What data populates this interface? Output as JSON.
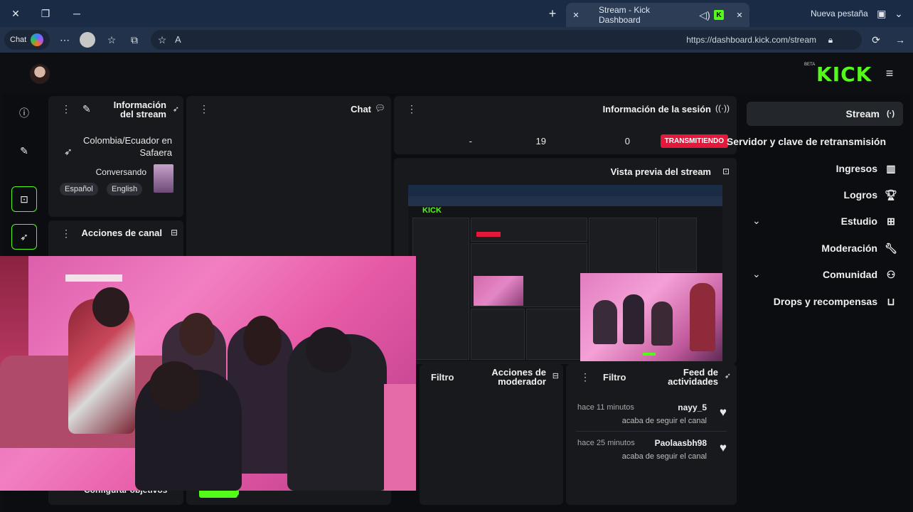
{
  "browser": {
    "tabs": [
      {
        "label": "Stream - Kick Dashboard",
        "active": true
      },
      {
        "label": "Nueva pestaña",
        "active": false
      }
    ],
    "url": "https://dashboard.kick.com/stream",
    "copilot_label": "Chat",
    "read_aloud": "A"
  },
  "brand": {
    "logo": "KICK",
    "badge": "BETA",
    "accent": "#53fc18"
  },
  "nav": {
    "items": [
      {
        "label": "Stream",
        "icon": "broadcast-icon",
        "active": true
      },
      {
        "label": "Servidor y clave de retransmisión",
        "icon": "",
        "active": false
      },
      {
        "label": "Ingresos",
        "icon": "bank-icon",
        "active": false
      },
      {
        "label": "Logros",
        "icon": "trophy-icon",
        "active": false
      },
      {
        "label": "Estudio",
        "icon": "studio-icon",
        "active": false,
        "expandable": true
      },
      {
        "label": "Moderación",
        "icon": "wrench-icon",
        "active": false
      },
      {
        "label": "Comunidad",
        "icon": "community-icon",
        "active": false,
        "expandable": true
      },
      {
        "label": "Drops y recompensas",
        "icon": "gift-icon",
        "active": false
      }
    ]
  },
  "session": {
    "title": "Información de la sesión",
    "status": "TRANSMITIENDO",
    "viewers": "0",
    "followers": "19",
    "duration": "-"
  },
  "preview": {
    "title": "Vista previa del stream"
  },
  "chat": {
    "title": "Chat"
  },
  "stream_info": {
    "title": "Información del stream",
    "stream_title": "Colombia/Ecuador en Safaera",
    "category": "Conversando",
    "tags": [
      "English",
      "Español"
    ]
  },
  "channel_actions": {
    "title": "Acciones de canal",
    "bottom_label": "Configurar objetivos"
  },
  "activity": {
    "title": "Feed de actividades",
    "filter": "Filtro",
    "items": [
      {
        "user": "nayy_5",
        "time": "hace 11 minutos",
        "desc": "acaba de seguir el canal"
      },
      {
        "user": "Paolaasbh98",
        "time": "hace 25 minutos",
        "desc": "acaba de seguir el canal"
      }
    ]
  },
  "mod_actions": {
    "title": "Acciones de moderador",
    "filter": "Filtro"
  },
  "colors": {
    "live": "#e3193b",
    "panel": "#18191d",
    "tabbar": "#1a2b45"
  }
}
